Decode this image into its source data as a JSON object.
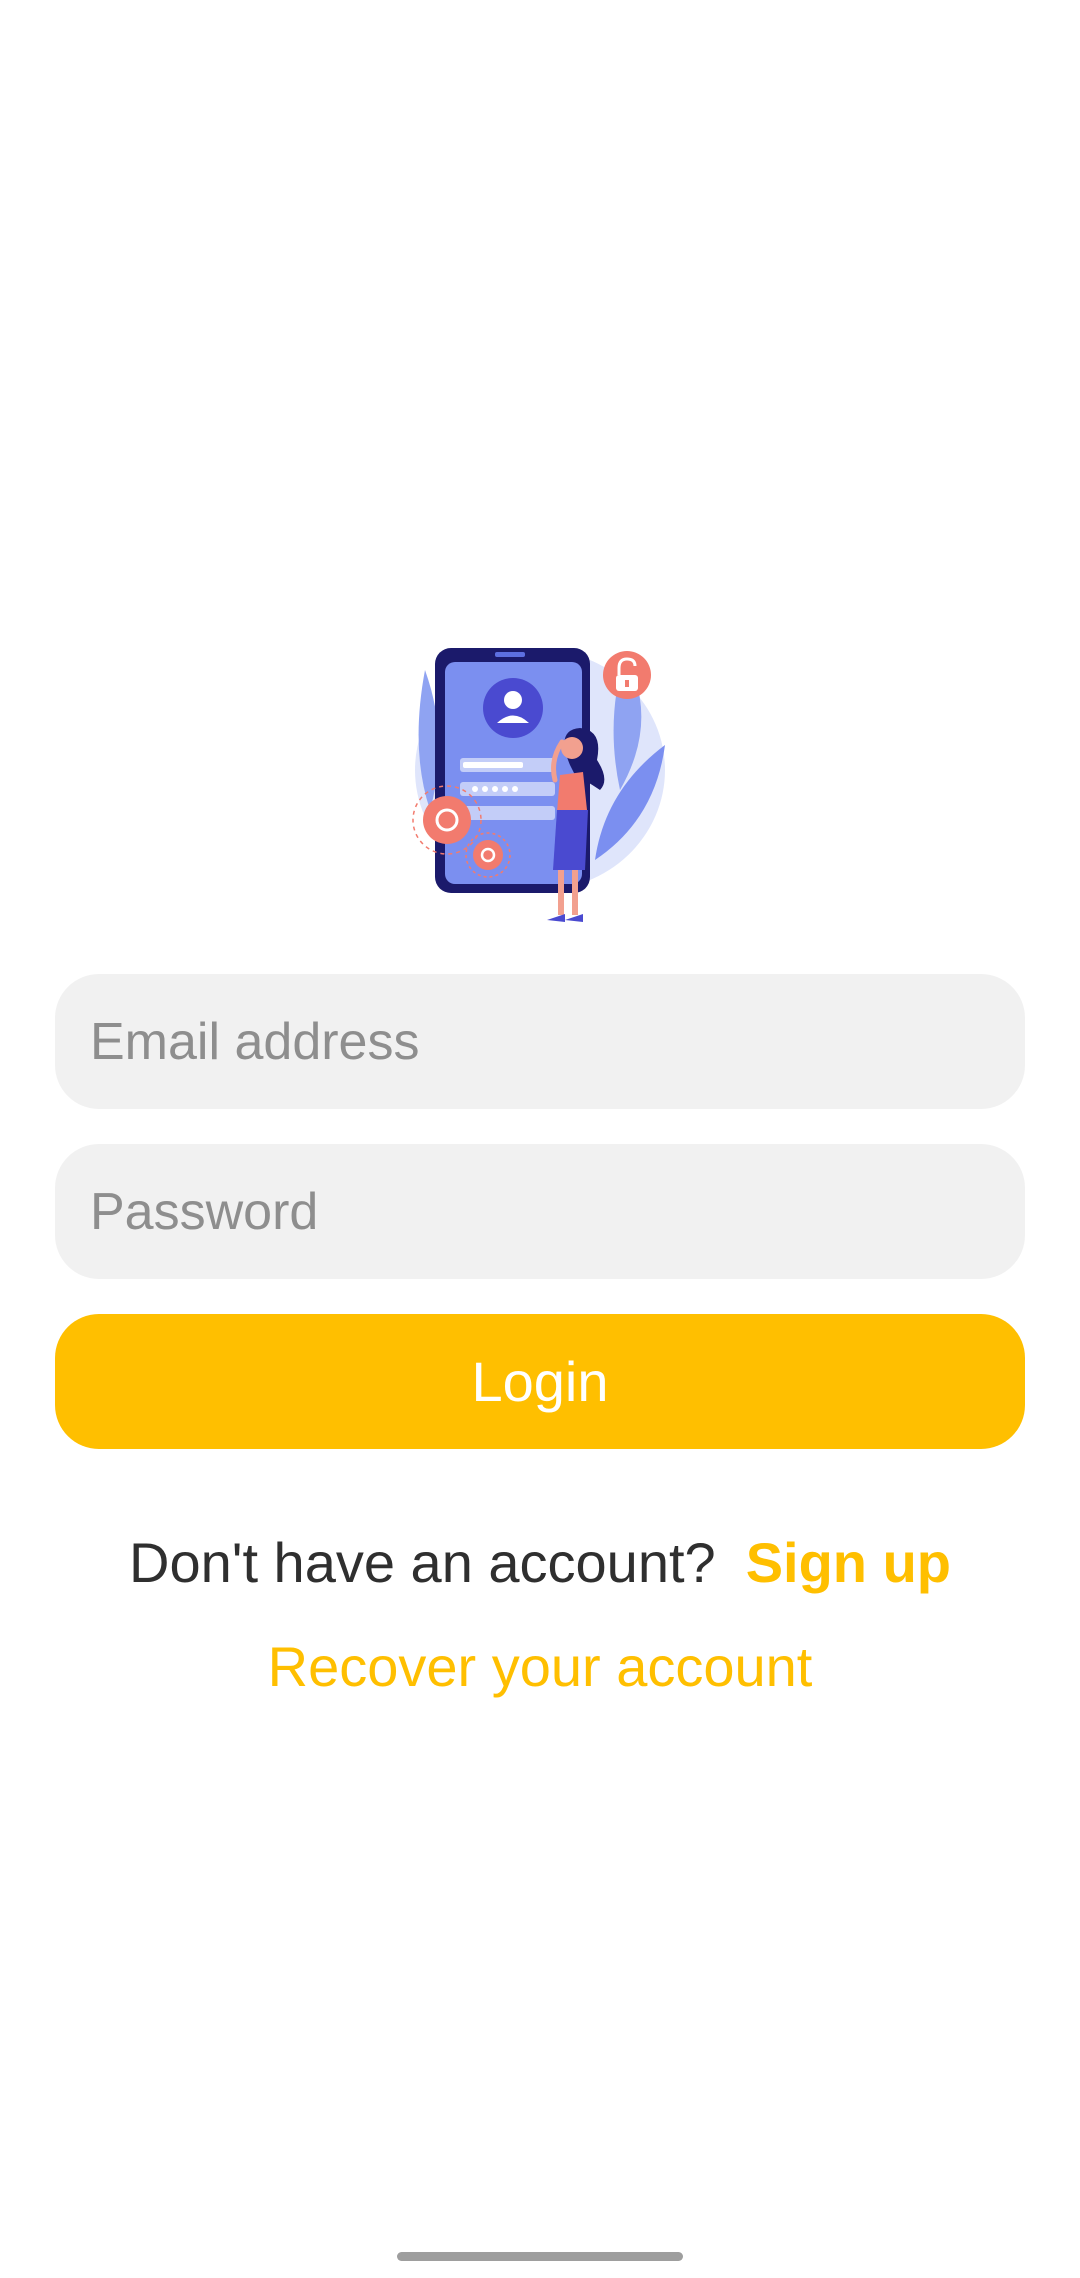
{
  "login_form": {
    "email_placeholder": "Email address",
    "email_value": "",
    "password_placeholder": "Password",
    "password_value": "",
    "login_label": "Login"
  },
  "signup": {
    "prompt": "Don't have an account?",
    "link_label": "Sign up"
  },
  "recover": {
    "link_label": "Recover your account"
  },
  "illustration": {
    "icon": "phone-login-illustration"
  },
  "colors": {
    "accent": "#ffbf00",
    "input_bg": "#f1f1f1",
    "text_dark": "#2f2f2f",
    "placeholder": "#8e8e8e",
    "illustration_navy": "#1b1a6b",
    "illustration_blue": "#7b8ff0",
    "illustration_coral": "#f27b6e"
  }
}
